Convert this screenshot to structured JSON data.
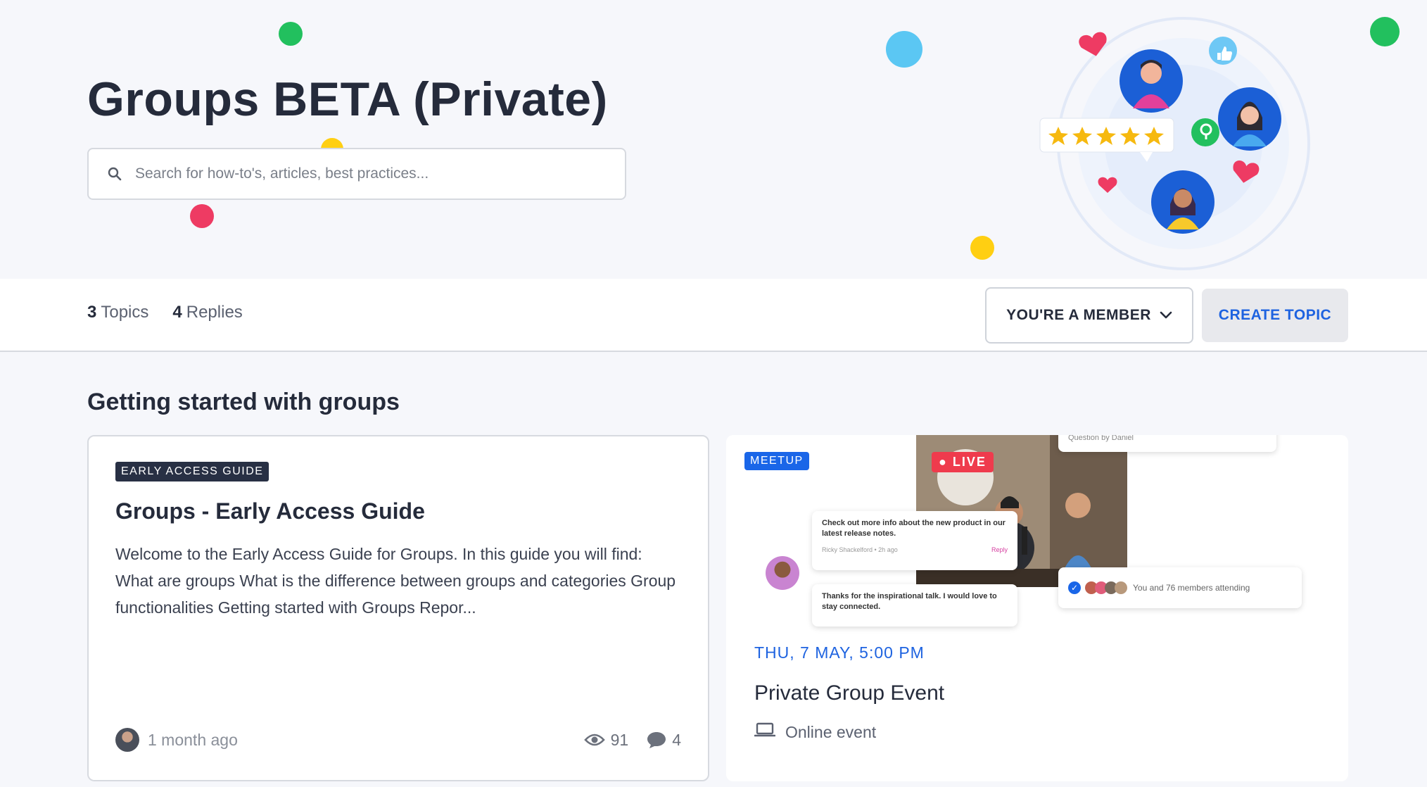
{
  "header": {
    "title": "Groups BETA (Private)",
    "search_placeholder": "Search for how-to's, articles, best practices..."
  },
  "stats": {
    "topics_count": "3",
    "topics_label": "Topics",
    "replies_count": "4",
    "replies_label": "Replies"
  },
  "actions": {
    "member_label": "YOU'RE A MEMBER",
    "create_label": "CREATE TOPIC"
  },
  "section": {
    "title": "Getting started with groups"
  },
  "guide_card": {
    "badge": "EARLY ACCESS GUIDE",
    "title": "Groups - Early Access Guide",
    "excerpt": "Welcome to the Early Access Guide for Groups. In this guide you will find: What are groups What is the difference between groups and categories Group functionalities Getting started with Groups Repor...",
    "time": "1 month ago",
    "views": "91",
    "replies": "4"
  },
  "event_card": {
    "badge": "MEETUP",
    "live_label": "LIVE",
    "bubble_question": "Question by Daniel",
    "bubble_info": "Check out more info about the new product in our latest release notes.",
    "bubble_info_meta": "Ricky Shackelford • 2h ago",
    "bubble_info_reply": "Reply",
    "bubble_thanks": "Thanks for the inspirational talk. I would love to stay connected.",
    "attending_text": "You and 76 members attending",
    "date": "THU, 7 MAY, 5:00 PM",
    "title": "Private Group Event",
    "location": "Online event"
  },
  "colors": {
    "accent_blue": "#1e63e0",
    "dark_text": "#252b3b",
    "live_red": "#ef3b4d",
    "dot_green": "#22c05e",
    "dot_blue": "#5bc7f3",
    "dot_yellow": "#ffcf12",
    "dot_red": "#ee3b63"
  },
  "icons": [
    "search-icon",
    "chevron-down-icon",
    "eye-icon",
    "comment-icon",
    "laptop-icon",
    "heart-icon",
    "star-icon",
    "like-icon",
    "lightbulb-icon",
    "check-icon"
  ]
}
